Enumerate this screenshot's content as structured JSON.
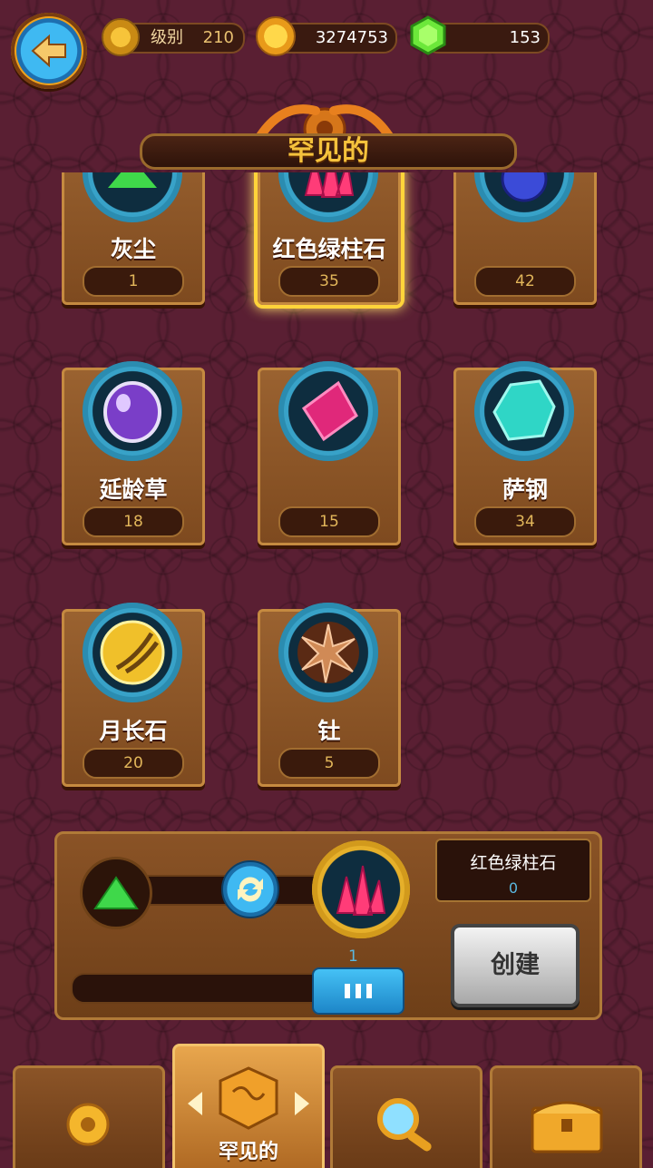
{
  "header": {
    "level_label": "级别",
    "level_value": "210",
    "coins": "3274753",
    "gems": "153"
  },
  "title": "罕见的",
  "items": [
    {
      "name": "灰尘",
      "count": "1",
      "color": "#3fd84a"
    },
    {
      "name": "红色绿柱石",
      "count": "35",
      "color": "#ff3c78",
      "selected": true
    },
    {
      "name": "",
      "count": "42",
      "color": "#3b4bd8"
    },
    {
      "name": "延龄草",
      "count": "18",
      "color": "#9b5be0"
    },
    {
      "name": "",
      "count": "15",
      "color": "#e0287a"
    },
    {
      "name": "萨钢",
      "count": "34",
      "color": "#2fd6c6"
    },
    {
      "name": "月长石",
      "count": "20",
      "color": "#f0c02a"
    },
    {
      "name": "钍",
      "count": "5",
      "color": "#d08a56"
    }
  ],
  "craft": {
    "result_name": "红色绿柱石",
    "result_count": "0",
    "amount": "1",
    "create_label": "创建"
  },
  "tabs": [
    {
      "label": "",
      "icon": "gear-icon"
    },
    {
      "label": "罕见的",
      "icon": "dice-icon"
    },
    {
      "label": "",
      "icon": "magnifier-icon"
    },
    {
      "label": "",
      "icon": "chest-icon"
    }
  ]
}
